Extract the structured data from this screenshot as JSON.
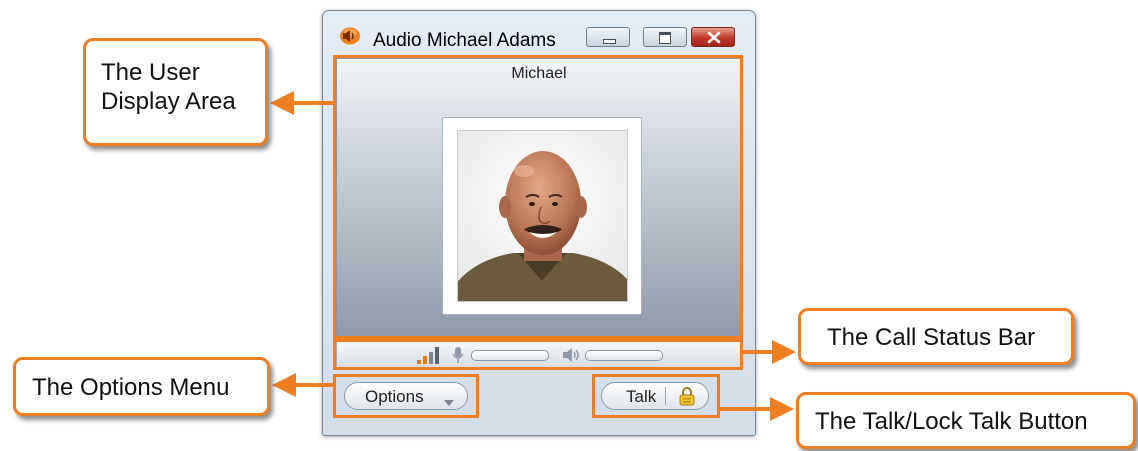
{
  "window": {
    "title": "Audio Michael Adams",
    "controls": [
      "minimize",
      "maximize",
      "close"
    ]
  },
  "display_area": {
    "participant_name": "Michael",
    "photo": "contact-photo"
  },
  "status_bar": {
    "signal_icon": "signal-strength-icon",
    "mic_icon": "microphone-icon",
    "speaker_icon": "speaker-icon"
  },
  "buttons": {
    "options_label": "Options",
    "talk_label": "Talk",
    "lock_icon": "lock-icon"
  },
  "callouts": {
    "user_display_line1": "The User",
    "user_display_line2": "Display Area",
    "call_status_bar": "The Call Status Bar",
    "options_menu": "The Options Menu",
    "talk_lock": "The Talk/Lock Talk Button"
  },
  "colors": {
    "accent_orange": "#ef7e22",
    "close_red": "#c0392b",
    "window_frame": "#d3dde9"
  }
}
